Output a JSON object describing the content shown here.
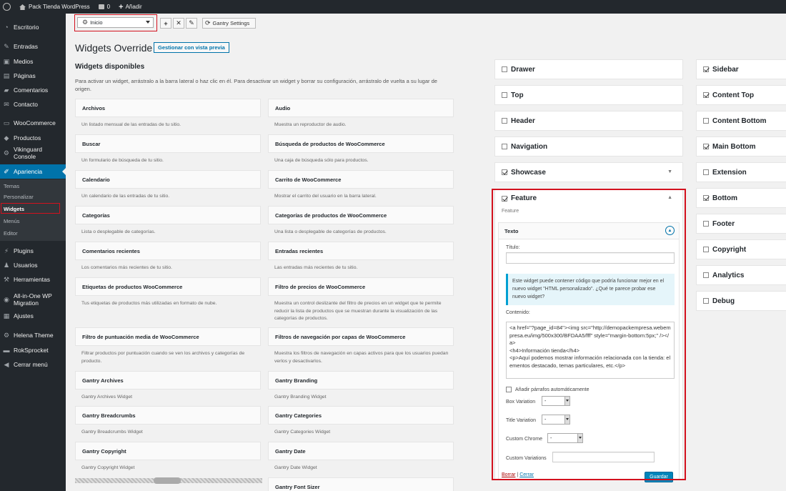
{
  "adminbar": {
    "site_name": "Pack Tienda WordPress",
    "comments_count": "0",
    "new_label": "Añadir"
  },
  "sidebar": {
    "items": [
      {
        "label": "Escritorio",
        "icon": "dashboard-icon"
      },
      {
        "label": "Entradas",
        "icon": "pin-icon"
      },
      {
        "label": "Medios",
        "icon": "media-icon"
      },
      {
        "label": "Páginas",
        "icon": "pages-icon"
      },
      {
        "label": "Comentarios",
        "icon": "comments-icon"
      },
      {
        "label": "Contacto",
        "icon": "mail-icon"
      },
      {
        "label": "WooCommerce",
        "icon": "woo-icon"
      },
      {
        "label": "Productos",
        "icon": "products-icon"
      },
      {
        "label": "Vikinguard Console",
        "icon": "gear-icon"
      },
      {
        "label": "Apariencia",
        "icon": "brush-icon"
      },
      {
        "label": "Plugins",
        "icon": "plugin-icon"
      },
      {
        "label": "Usuarios",
        "icon": "user-icon"
      },
      {
        "label": "Herramientas",
        "icon": "wrench-icon"
      },
      {
        "label": "All-in-One WP Migration",
        "icon": "migration-icon"
      },
      {
        "label": "Ajustes",
        "icon": "settings-icon"
      },
      {
        "label": "Helena Theme",
        "icon": "gear-icon"
      },
      {
        "label": "RokSprocket",
        "icon": "rok-icon"
      },
      {
        "label": "Cerrar menú",
        "icon": "collapse-icon"
      }
    ],
    "submenu": [
      "Temas",
      "Personalizar",
      "Widgets",
      "Menús",
      "Editor"
    ]
  },
  "toolbar": {
    "select_value": "Inicio",
    "add_symbol": "+",
    "remove_symbol": "✕",
    "edit_symbol": "✎",
    "gantry_settings": "Gantry Settings"
  },
  "page": {
    "title": "Widgets Override",
    "preview_button": "Gestionar con vista previa",
    "available_title": "Widgets disponibles",
    "available_desc": "Para activar un widget, arrástralo a la barra lateral o haz clic en él. Para desactivar un widget y borrar su configuración, arrástralo de vuelta a su lugar de origen."
  },
  "widgets_left": [
    {
      "name": "Archivos",
      "desc": "Un listado mensual de las entradas de tu sitio."
    },
    {
      "name": "Buscar",
      "desc": "Un formulario de búsqueda de tu sitio."
    },
    {
      "name": "Calendario",
      "desc": "Un calendario de las entradas de tu sitio."
    },
    {
      "name": "Categorías",
      "desc": "Lista o desplegable de categorías."
    },
    {
      "name": "Comentarios recientes",
      "desc": "Los comentarios más recientes de tu sitio."
    },
    {
      "name": "Etiquetas de productos WooCommerce",
      "desc": "Tus etiquetas de productos más utilizadas en formato de nube."
    },
    {
      "name": "Filtro de puntuación media de WooCommerce",
      "desc": "Filtrar productos por puntuación cuando se ven los archivos y categorías de producto."
    },
    {
      "name": "Gantry Archives",
      "desc": "Gantry Archives Widget"
    },
    {
      "name": "Gantry Breadcrumbs",
      "desc": "Gantry Breadcrumbs Widget"
    },
    {
      "name": "Gantry Copyright",
      "desc": "Gantry Copyright Widget"
    }
  ],
  "widgets_right": [
    {
      "name": "Audio",
      "desc": "Muestra un reproductor de audio."
    },
    {
      "name": "Búsqueda de productos de WooCommerce",
      "desc": "Una caja de búsqueda sólo para productos."
    },
    {
      "name": "Carrito de WooCommerce",
      "desc": "Mostrar el carrito del usuario en la barra lateral."
    },
    {
      "name": "Categorías de productos de WooCommerce",
      "desc": "Una lista o desplegable de categorías de productos."
    },
    {
      "name": "Entradas recientes",
      "desc": "Las entradas más recientes de tu sitio."
    },
    {
      "name": "Filtro de precios de WooCommerce",
      "desc": "Muestra un control deslizante del filtro de precios en un widget que te permite reducir la lista de productos que se muestran durante la visualización de las categorías de productos."
    },
    {
      "name": "Filtros de navegación por capas de WooCommerce",
      "desc": "Muestra los filtros de navegación en capas activos para que los usuarios puedan verlos y desactivarlos."
    },
    {
      "name": "Gantry Branding",
      "desc": "Gantry Branding Widget"
    },
    {
      "name": "Gantry Categories",
      "desc": "Gantry Categories Widget"
    },
    {
      "name": "Gantry Date",
      "desc": "Gantry Date Widget"
    },
    {
      "name": "Gantry Font Sizer",
      "desc": ""
    }
  ],
  "sidebars_mid": [
    {
      "name": "Drawer",
      "checked": false
    },
    {
      "name": "Top",
      "checked": false
    },
    {
      "name": "Header",
      "checked": false
    },
    {
      "name": "Navigation",
      "checked": false
    },
    {
      "name": "Showcase",
      "checked": true
    }
  ],
  "sidebars_right": [
    {
      "name": "Sidebar",
      "checked": true
    },
    {
      "name": "Content Top",
      "checked": true
    },
    {
      "name": "Content Bottom",
      "checked": false
    },
    {
      "name": "Main Bottom",
      "checked": true
    },
    {
      "name": "Extension",
      "checked": false
    },
    {
      "name": "Bottom",
      "checked": true
    },
    {
      "name": "Footer",
      "checked": false
    },
    {
      "name": "Copyright",
      "checked": false
    },
    {
      "name": "Analytics",
      "checked": false
    },
    {
      "name": "Debug",
      "checked": false
    }
  ],
  "feature": {
    "name": "Feature",
    "checked": true,
    "desc": "Feature",
    "widget_name": "Texto",
    "title_label": "Título:",
    "title_value": "",
    "notice": "Este widget puede contener código que podría funcionar mejor en el nuevo widget \"HTML personalizado\". ¿Qué te parece probar ese nuevo widget?",
    "content_label": "Contenido:",
    "content_value": "<a href=\"?page_id=84\"><img src=\"http://demopackempresa.webempresa.eu/img/500x300/BFDAA5/fff\" style=\"margin-bottom:5px;\" /></a>\n<h4>Información tienda</h4>\n<p>Aquí podemos mostrar información relacionada con la tienda: elementos destacado, temas particulares, etc.</p>",
    "autop_label": "Añadir párrafos automáticamente",
    "box_variation_label": "Box Variation",
    "box_variation_value": "-",
    "title_variation_label": "Title Variation",
    "title_variation_value": "-",
    "custom_chrome_label": "Custom Chrome",
    "custom_chrome_value": "-",
    "custom_variations_label": "Custom Variations",
    "custom_variations_value": "",
    "delete_link": "Borrar",
    "separator": "|",
    "close_link": "Cerrar",
    "save_button": "Guardar"
  },
  "colors": {
    "adminbar_bg": "#23282d",
    "accent": "#0073aa",
    "highlight_box": "#d3111e"
  }
}
